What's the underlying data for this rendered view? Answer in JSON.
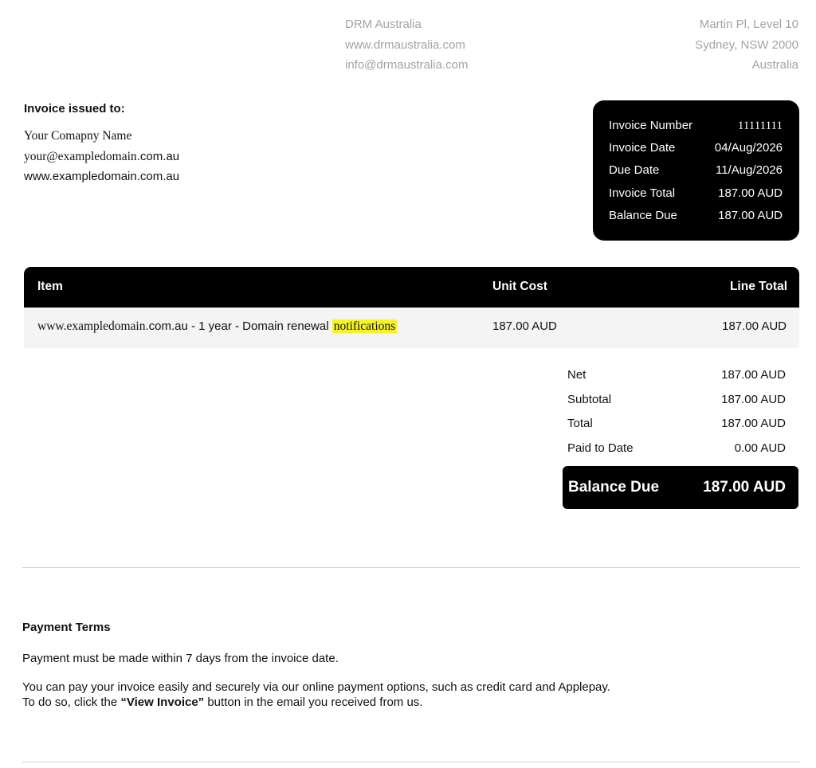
{
  "company": {
    "name": "DRM Australia",
    "website": "www.drmaustralia.com",
    "email": "info@drmaustralia.com"
  },
  "address": {
    "line1": "Martin Pl, Level 10",
    "line2": "Sydney, NSW 2000",
    "line3": "Australia"
  },
  "issued_to": {
    "title": "Invoice issued to:",
    "name": "Your Comapny Name",
    "email_local": "your@exampledomain",
    "email_tld": ".com.au",
    "website": "www.exampledomain.com.au"
  },
  "invoice_meta": [
    {
      "label": "Invoice Number",
      "value": "11111111"
    },
    {
      "label": "Invoice Date",
      "value": "04/Aug/2026"
    },
    {
      "label": "Due Date",
      "value": "11/Aug/2026"
    },
    {
      "label": "Invoice Total",
      "value": "187.00 AUD"
    },
    {
      "label": "Balance Due",
      "value": "187.00 AUD"
    }
  ],
  "table": {
    "headers": {
      "item": "Item",
      "unit_cost": "Unit Cost",
      "line_total": "Line Total"
    },
    "rows": [
      {
        "item_domain": "www.exampledomain",
        "item_rest": ".com.au - 1 year - Domain renewal ",
        "item_highlight": "notifications",
        "unit_cost": "187.00 AUD",
        "line_total": "187.00 AUD"
      }
    ]
  },
  "summary": [
    {
      "label": "Net",
      "value": "187.00 AUD"
    },
    {
      "label": "Subtotal",
      "value": "187.00 AUD"
    },
    {
      "label": "Total",
      "value": "187.00 AUD"
    },
    {
      "label": "Paid to Date",
      "value": "0.00 AUD"
    }
  ],
  "balance_due": {
    "label": "Balance Due",
    "value": "187.00 AUD"
  },
  "payment_terms": {
    "title": "Payment Terms",
    "line1": "Payment must be made within 7 days from the invoice date.",
    "line2": "You can pay your invoice easily and securely via our online payment options, such as credit card and Applepay.",
    "line3_pre": "To do so, click the ",
    "line3_bold": "“View Invoice”",
    "line3_post": " button in the email you received from us."
  },
  "colors": {
    "highlight": "#f7f425",
    "dark": "#000000",
    "muted": "#a3a3a3"
  }
}
